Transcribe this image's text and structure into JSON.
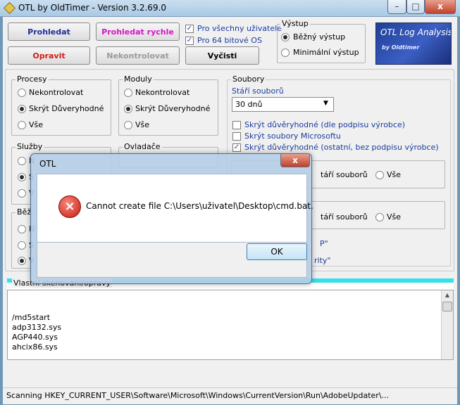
{
  "window": {
    "title": "OTL by OldTimer - Version 3.2.69.0"
  },
  "titlebar_buttons": {
    "minimize": "–",
    "maximize": "□",
    "close": "x"
  },
  "toolbar": {
    "scan": "Prohledat",
    "scan_fast": "Prohledat rychle",
    "fix": "Opravit",
    "nocheck": "Nekontrolovat",
    "clean": "Vyčisti",
    "all_users": "Pro všechny uživatele",
    "os64": "Pro 64 bitové OS"
  },
  "output": {
    "title": "Výstup",
    "standard": "Běžný výstup",
    "minimal": "Minimální výstup"
  },
  "logo": {
    "title": "OTL Log Analysis",
    "subtitle": "by Oldtimer"
  },
  "processes": {
    "title": "Procesy",
    "opt1": "Nekontrolovat",
    "opt2": "Skrýt Důveryhodné",
    "opt3": "Vše"
  },
  "modules": {
    "title": "Moduly",
    "opt1": "Nekontrolovat",
    "opt2": "Skrýt Důveryhodné",
    "opt3": "Vše"
  },
  "services": {
    "title": "Služby",
    "opt1": "N",
    "opt2": "S",
    "opt3": "V"
  },
  "drivers": {
    "title": "Ovladače"
  },
  "standard_reg": {
    "title": "Běž",
    "opt1": "N",
    "opt2": "S",
    "opt3": "V"
  },
  "files": {
    "title": "Soubory",
    "age_label": "Stáří souborů",
    "age_value": "30 dnů",
    "chk1": "Skrýt důvěryhodné (dle podpisu výrobce)",
    "chk2": "Skrýt soubory Microsoftu",
    "chk3": "Skrýt důvěryhodné (ostatní, bez podpisu výrobce)",
    "row1_age": "táří souborů",
    "row1_all": "Vše",
    "row2_age": "táří souborů",
    "row2_all": "Vše",
    "link1": "P\"",
    "link2": "rity\""
  },
  "custom": {
    "title": "Vlastní skenování/opravy",
    "lines": [
      "/md5start",
      "adp3132.sys",
      "AGP440.sys",
      "ahcix86.sys"
    ]
  },
  "status": {
    "text": "Scanning HKEY_CURRENT_USER\\Software\\Microsoft\\Windows\\CurrentVersion\\Run\\AdobeUpdater\\..."
  },
  "dialog": {
    "title": "OTL",
    "close": "x",
    "icon": "×",
    "message": "Cannot create file C:\\Users\\uživatel\\Desktop\\cmd.bat.",
    "ok": "OK"
  }
}
